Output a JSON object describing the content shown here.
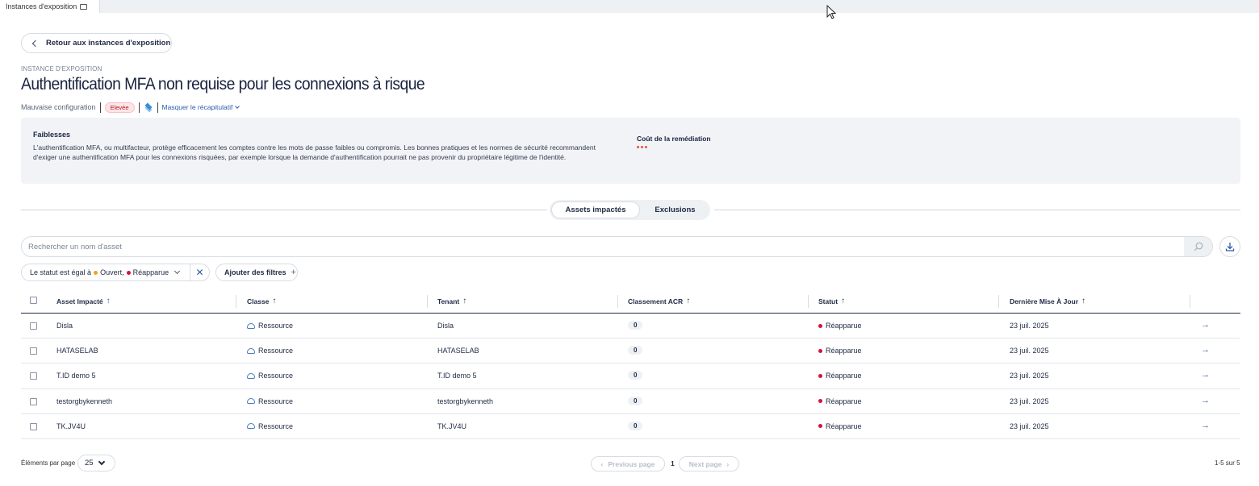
{
  "tab": {
    "label": "Instances d'exposition"
  },
  "header": {
    "back_label": "Retour aux instances d'exposition",
    "eyebrow": "INSTANCE D'EXPOSITION",
    "title": "Authentification MFA non requise pour les connexions à risque",
    "category": "Mauvaise configuration",
    "severity": "Elevée",
    "toggle_summary": "Masquer le récapitulatif"
  },
  "summary": {
    "heading": "Faiblesses",
    "text": "L'authentification MFA, ou multifacteur, protège efficacement les comptes contre les mots de passe faibles ou compromis. Les bonnes pratiques et les normes de sécurité recommandent d'exiger une authentification MFA pour les connexions risquées, par exemple lorsque la demande d'authentification pourrait ne pas provenir du propriétaire légitime de l'identité.",
    "cost_heading": "Coût de la remédiation"
  },
  "tabs": [
    {
      "label": "Assets impactés",
      "active": true
    },
    {
      "label": "Exclusions",
      "active": false
    }
  ],
  "search": {
    "placeholder": "Rechercher un nom d'asset",
    "value": ""
  },
  "filters": {
    "status_prefix": "Le statut est égal à",
    "status_open": "Ouvert,",
    "status_reappeared": "Réapparue",
    "add_label": "Ajouter des filtres",
    "clear_glyph": "✕",
    "add_glyph": "+"
  },
  "table": {
    "columns": [
      {
        "label": "Asset Impacté",
        "sort_glyph": "↑"
      },
      {
        "label": "Classe",
        "sort_glyph": "↑"
      },
      {
        "label": "Tenant",
        "sort_glyph": "↑"
      },
      {
        "label": "Classement ACR",
        "sort_glyph": "↑"
      },
      {
        "label": "Statut",
        "sort_glyph": "↑"
      },
      {
        "label": "Dernière Mise À Jour",
        "sort_glyph": "↑"
      }
    ],
    "rows": [
      {
        "asset": "Disla",
        "class": "Ressource",
        "tenant": "Disla",
        "acr": "0",
        "status": "Réapparue",
        "updated": "23 juil. 2025"
      },
      {
        "asset": "HATASELAB",
        "class": "Ressource",
        "tenant": "HATASELAB",
        "acr": "0",
        "status": "Réapparue",
        "updated": "23 juil. 2025"
      },
      {
        "asset": "T.ID demo 5",
        "class": "Ressource",
        "tenant": "T.ID demo 5",
        "acr": "0",
        "status": "Réapparue",
        "updated": "23 juil. 2025"
      },
      {
        "asset": "testorgbykenneth",
        "class": "Ressource",
        "tenant": "testorgbykenneth",
        "acr": "0",
        "status": "Réapparue",
        "updated": "23 juil. 2025"
      },
      {
        "asset": "TK.JV4U",
        "class": "Ressource",
        "tenant": "TK.JV4U",
        "acr": "0",
        "status": "Réapparue",
        "updated": "23 juil. 2025"
      }
    ],
    "row_arrow_glyph": "→"
  },
  "footer": {
    "per_page_label": "Éléments par page",
    "per_page_value": "25",
    "prev_label": "Previous page",
    "prev_glyph": "‹",
    "next_label": "Next page",
    "next_glyph": "›",
    "current_page": "1",
    "range": "1-5 sur 5"
  },
  "colors": {
    "accent": "#2d5da8",
    "severity_bg": "#fde4e6",
    "severity_text": "#b2182b",
    "status_open": "#f3a21c",
    "status_reappeared": "#d4133b"
  },
  "icons": {
    "tab": "window-icon",
    "back": "chevron-left-icon",
    "layers": "layers-icon",
    "search": "search-icon",
    "download": "download-icon",
    "resource": "cloud-icon",
    "row_open": "arrow-right-icon"
  }
}
